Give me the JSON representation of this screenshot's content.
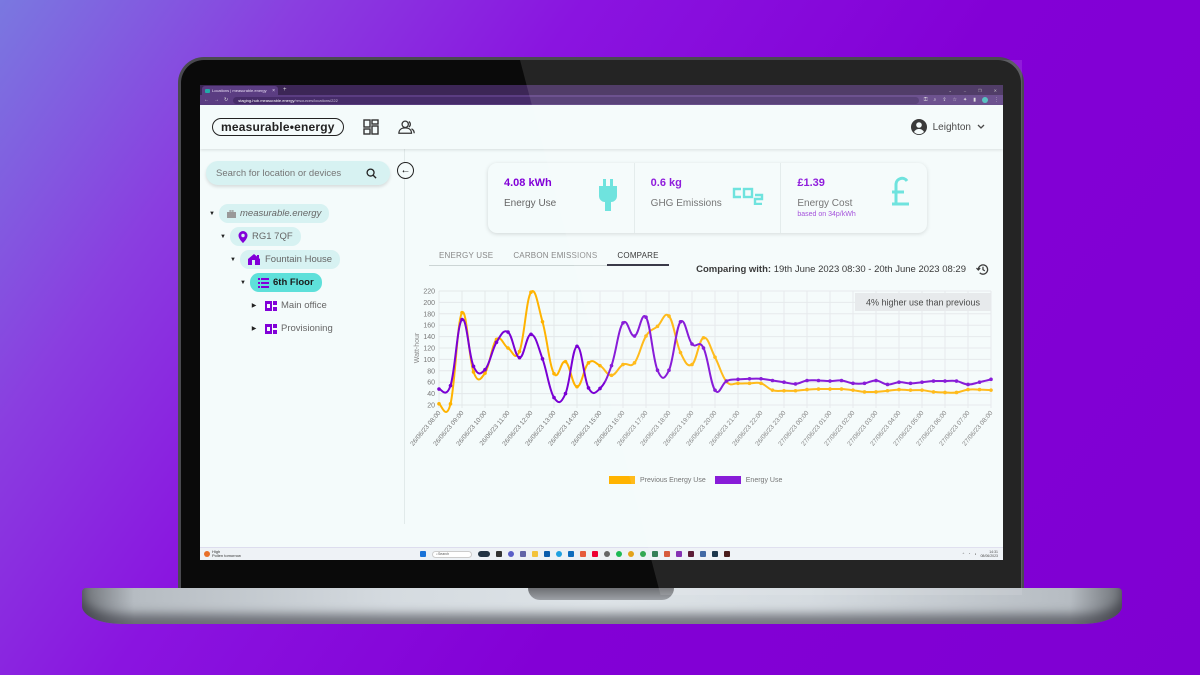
{
  "browser": {
    "tab_title": "Locations | measurable.energy",
    "new_tab": "+",
    "url_host": "staging-hub.measurable.energy",
    "url_path": "/resources/locations/222"
  },
  "header": {
    "logo": "measurable•energy",
    "user_name": "Leighton",
    "icons": [
      "dashboard-grid-icon",
      "users-icon",
      "account-circle-icon",
      "chevron-down-icon"
    ]
  },
  "sidebar": {
    "search_placeholder": "Search for location or devices",
    "tree": [
      {
        "label": "measurable.energy",
        "icon": "briefcase-icon",
        "level": 0,
        "expanded": true,
        "active": false,
        "italic": true
      },
      {
        "label": "RG1 7QF",
        "icon": "map-pin-icon",
        "level": 1,
        "expanded": true,
        "active": false
      },
      {
        "label": "Fountain House",
        "icon": "building-icon",
        "level": 2,
        "expanded": true,
        "active": false
      },
      {
        "label": "6th Floor",
        "icon": "list-icon",
        "level": 3,
        "expanded": true,
        "active": true
      },
      {
        "label": "Main office",
        "icon": "room-icon",
        "level": 4,
        "expanded": false,
        "active": false
      },
      {
        "label": "Provisioning",
        "icon": "room-icon",
        "level": 4,
        "expanded": false,
        "active": false
      }
    ]
  },
  "stats": [
    {
      "value": "4.08 kWh",
      "label": "Energy Use",
      "icon": "plug-icon"
    },
    {
      "value": "0.6 kg",
      "label": "GHG Emissions",
      "icon": "co2-icon"
    },
    {
      "value": "£1.39",
      "label": "Energy Cost",
      "sub": "based on 34p/kWh",
      "icon": "pound-icon"
    }
  ],
  "tabs": [
    {
      "label": "ENERGY USE",
      "active": false
    },
    {
      "label": "CARBON EMISSIONS",
      "active": false
    },
    {
      "label": "COMPARE",
      "active": true
    }
  ],
  "compare": {
    "prefix": "Comparing with:",
    "range": "19th June 2023 08:30 - 20th June 2023 08:29"
  },
  "colors": {
    "accent_purple": "#8200d8",
    "accent_teal": "#5ee0da",
    "previous_series": "#ffb300",
    "current_series": "#7a00d4"
  },
  "chart_data": {
    "type": "line",
    "title": "",
    "xlabel": "",
    "ylabel": "Watt-hour",
    "ylim": [
      20,
      220
    ],
    "yticks": [
      20,
      40,
      60,
      80,
      100,
      120,
      140,
      160,
      180,
      200,
      220
    ],
    "grid": true,
    "legend_position": "bottom",
    "annotation": "4% higher use than previous",
    "xtick_labels": [
      "26/06/23 08:00",
      "26/06/23 09:00",
      "26/06/23 10:00",
      "26/06/23 11:00",
      "26/06/23 12:00",
      "26/06/23 13:00",
      "26/06/23 14:00",
      "26/06/23 15:00",
      "26/06/23 16:00",
      "26/06/23 17:00",
      "26/06/23 18:00",
      "26/06/23 19:00",
      "26/06/23 20:00",
      "26/06/23 21:00",
      "26/06/23 22:00",
      "26/06/23 23:00",
      "27/06/23 00:00",
      "27/06/23 01:00",
      "27/06/23 02:00",
      "27/06/23 03:00",
      "27/06/23 04:00",
      "27/06/23 05:00",
      "27/06/23 06:00",
      "27/06/23 07:00",
      "27/06/23 08:00"
    ],
    "x_interval": "30 min",
    "series": [
      {
        "name": "Previous Energy Use",
        "color": "#ffb300",
        "values": [
          22,
          22,
          182,
          78,
          76,
          135,
          120,
          114,
          218,
          166,
          75,
          96,
          52,
          94,
          89,
          72,
          91,
          94,
          141,
          158,
          176,
          112,
          91,
          138,
          104,
          61,
          58,
          58,
          58,
          46,
          45,
          45,
          47,
          48,
          48,
          48,
          46,
          43,
          43,
          45,
          47,
          46,
          46,
          43,
          42,
          42,
          47,
          47,
          46
        ]
      },
      {
        "name": "Energy Use",
        "color": "#7a00d4",
        "values": [
          48,
          54,
          170,
          88,
          82,
          130,
          148,
          103,
          144,
          101,
          33,
          40,
          123,
          50,
          49,
          89,
          164,
          141,
          174,
          81,
          81,
          166,
          127,
          120,
          46,
          62,
          65,
          66,
          66,
          63,
          60,
          57,
          63,
          63,
          62,
          63,
          58,
          58,
          63,
          56,
          60,
          58,
          60,
          62,
          62,
          62,
          56,
          60,
          65
        ]
      }
    ]
  },
  "taskbar": {
    "weather_title": "High",
    "weather_sub": "Pollen tomorrow",
    "search_label": "Search",
    "time": "14:31",
    "date": "08/06/2023"
  }
}
